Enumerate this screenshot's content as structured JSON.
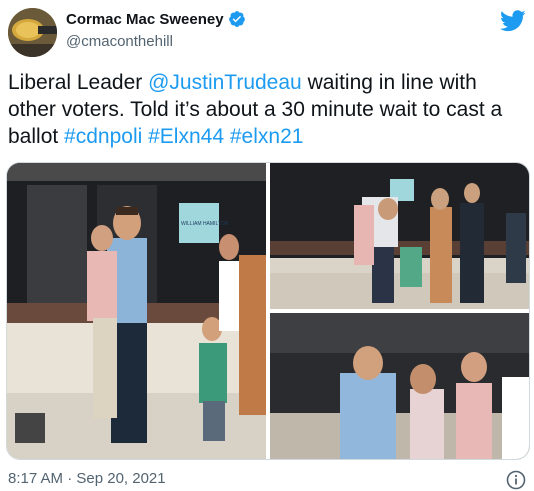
{
  "author": {
    "display_name": "Cormac Mac Sweeney",
    "handle": "@cmaconthehill",
    "avatar_icon": "microphone-icon",
    "verified_icon": "verified-badge-icon"
  },
  "brand": {
    "logo_icon": "twitter-bird-icon",
    "color": "#1d9bf0"
  },
  "tweet": {
    "segments": [
      {
        "text": "Liberal Leader "
      },
      {
        "text": "@JustinTrudeau",
        "link": true
      },
      {
        "text": " waiting in line with other voters. Told it’s about a 30 minute wait to cast a ballot "
      },
      {
        "text": "#cdnpoli",
        "link": true
      },
      {
        "text": " "
      },
      {
        "text": "#Elxn44",
        "link": true
      },
      {
        "text": " "
      },
      {
        "text": "#elxn21",
        "link": true
      }
    ]
  },
  "media": {
    "photos": [
      {
        "sign_text": "WILLIAM HAMILTON"
      },
      {
        "sign_text": ""
      },
      {
        "sign_text": ""
      }
    ]
  },
  "meta": {
    "timestamp": "8:17 AM · Sep 20, 2021",
    "info_icon": "info-icon"
  }
}
